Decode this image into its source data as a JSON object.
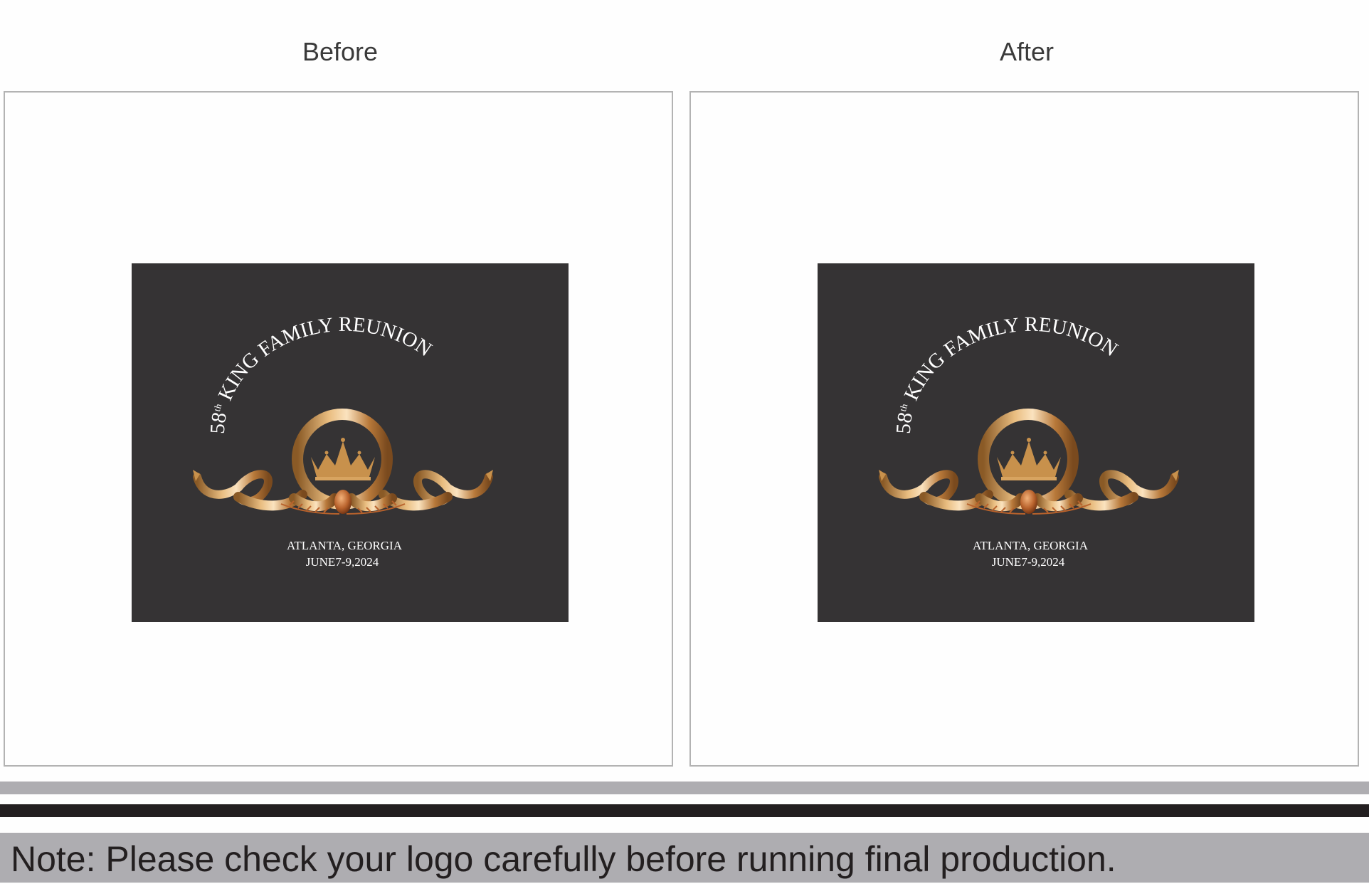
{
  "panels": {
    "before": {
      "title": "Before"
    },
    "after": {
      "title": "After"
    }
  },
  "logo": {
    "ordinal_number": "58",
    "ordinal_suffix": "th",
    "headline": "KING FAMILY REUNION",
    "location": "ATLANTA, GEORGIA",
    "date": "JUNE7-9,2024",
    "background_color": "#353334",
    "gold_color": "#c8914c"
  },
  "footer": {
    "note": "Note: Please check your logo carefully before running final production."
  },
  "colors": {
    "stripe_gray": "#aeadb1",
    "stripe_black": "#231f20",
    "panel_border": "#b3b3b3"
  }
}
